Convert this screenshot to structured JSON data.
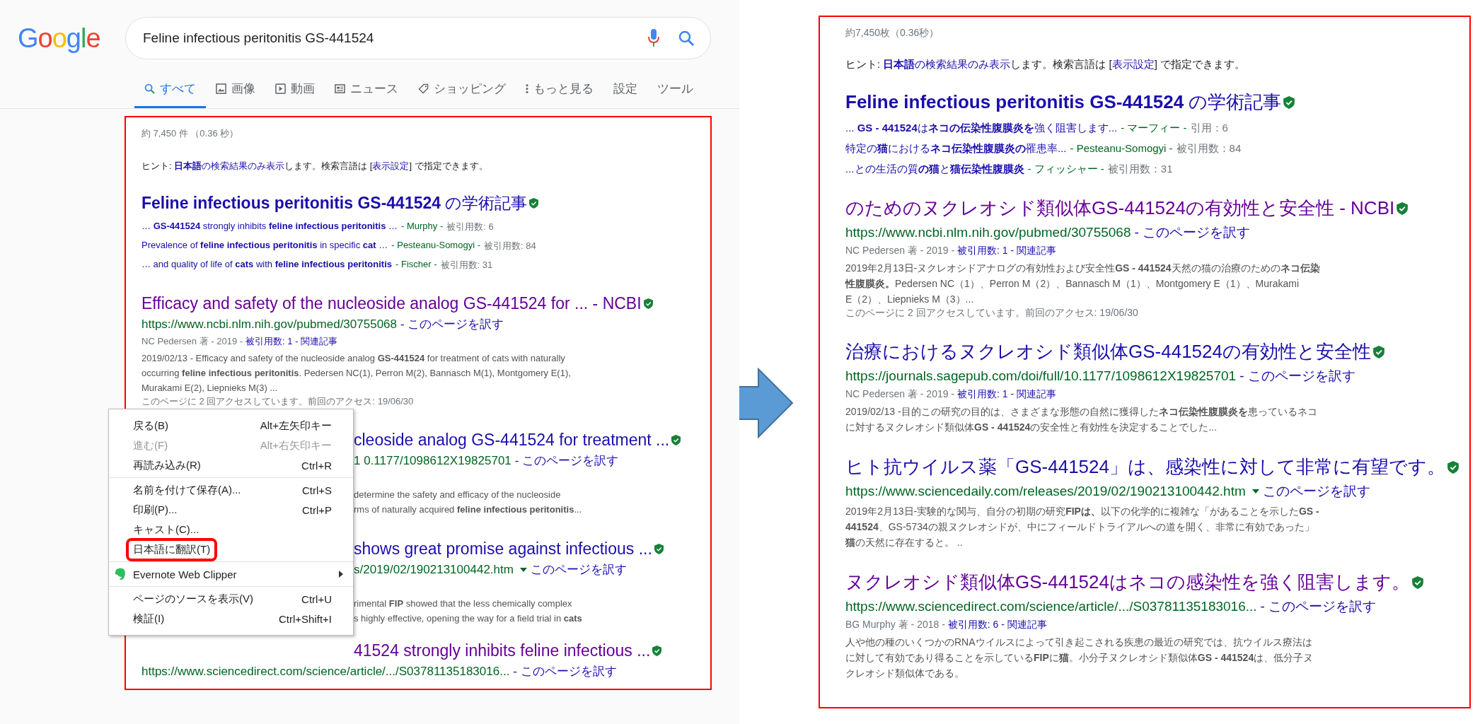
{
  "left": {
    "logo": [
      {
        "char": "G",
        "color": "#4285f4"
      },
      {
        "char": "o",
        "color": "#ea4335"
      },
      {
        "char": "o",
        "color": "#fbbc05"
      },
      {
        "char": "g",
        "color": "#4285f4"
      },
      {
        "char": "l",
        "color": "#34a853"
      },
      {
        "char": "e",
        "color": "#ea4335"
      }
    ],
    "search": {
      "value": "Feline infectious peritonitis GS-441524"
    },
    "tabs": [
      {
        "label": "すべて",
        "kind": "search",
        "selected": true
      },
      {
        "label": "画像",
        "kind": "image",
        "selected": false
      },
      {
        "label": "動画",
        "kind": "video",
        "selected": false
      },
      {
        "label": "ニュース",
        "kind": "news",
        "selected": false
      },
      {
        "label": "ショッピング",
        "kind": "tag",
        "selected": false
      },
      {
        "label": "もっと見る",
        "kind": "dots",
        "selected": false
      },
      {
        "label": "設定",
        "kind": "plain",
        "selected": false
      },
      {
        "label": "ツール",
        "kind": "plain",
        "selected": false
      }
    ],
    "stats": "約 7,450 件 （0.36 秒）",
    "hint": [
      {
        "kind": "text",
        "text": "ヒント: "
      },
      {
        "kind": "link",
        "text": "**日本語**の検索結果のみ表示"
      },
      {
        "kind": "text",
        "text": "します。検索言語は ["
      },
      {
        "kind": "link",
        "text": "表示設定"
      },
      {
        "kind": "text",
        "text": "] で指定できます。"
      }
    ],
    "scholar": {
      "title": "**Feline infectious peritonitis GS-441524** の学術記事",
      "verified": true,
      "lines": [
        {
          "text": "… **GS-441524** strongly inhibits **feline infectious peritonitis** …",
          "author": "- Murphy -",
          "cited": "被引用数: 6"
        },
        {
          "text": "Prevalence of **feline infectious peritonitis** in specific **cat** …",
          "author": "- Pesteanu-Somogyi -",
          "cited": "被引用数: 84"
        },
        {
          "text": "… and quality of life of **cats** with **feline infectious peritonitis**",
          "author": "- Fischer -",
          "cited": "被引用数: 31"
        }
      ]
    },
    "results": [
      {
        "kind": "web",
        "visited": true,
        "title": "Efficacy and safety of the nucleoside analog GS-441524 for ... - NCBI",
        "verified": true,
        "url": "https://www.ncbi.nlm.nih.gov/pubmed/30755068",
        "dropdown": false,
        "translate": "- このページを訳す",
        "meta": {
          "by": "NC Pedersen 著 - 2019 -",
          "cited": "被引用数: 1 -",
          "related": "関連記事"
        },
        "snippet": [
          "2019/02/13 - Efficacy and safety of the nucleoside analog **GS-441524** for treatment of cats with naturally",
          "occurring **feline infectious peritonitis**. Pedersen NC(1), Perron M(2), Bannasch M(1), Montgomery E(1),",
          "Murakami E(2), Liepnieks M(3) ..."
        ],
        "visit_note": "このページに 2 回アクセスしています。前回のアクセス: 19/06/30"
      },
      {
        "kind": "covered",
        "visited": false,
        "title": "cleoside analog GS-441524 for treatment ...",
        "verified": true,
        "url": "1 0.1177/1098612X19825701",
        "dropdown": false,
        "translate": "- このページを訳す",
        "snippet": [
          "determine the safety and efficacy of the nucleoside",
          "rms of naturally acquired **feline infectious peritonitis**..."
        ]
      },
      {
        "kind": "covered",
        "visited": false,
        "title": "shows great promise against infectious ...",
        "verified": true,
        "url": "s/2019/02/190213100442.htm",
        "dropdown": true,
        "translate": "このページを訳す",
        "snippet": [
          "rimental **FIP** showed that the less chemically complex",
          "s  highly effective, opening the way for a field trial in **cats**"
        ]
      },
      {
        "kind": "title-covered",
        "visited": true,
        "title": "41524 strongly inhibits feline infectious ...",
        "verified": true,
        "url": "https://www.sciencedirect.com/science/article/.../S03781135183016...",
        "dropdown": false,
        "translate": "- このページを訳す"
      }
    ],
    "context_menu": {
      "sections": [
        [
          {
            "label": "戻る(B)",
            "shortcut": "Alt+左矢印キー",
            "kind": "plain",
            "disabled": false,
            "highlighted": false
          },
          {
            "label": "進む(F)",
            "shortcut": "Alt+右矢印キー",
            "kind": "plain",
            "disabled": true,
            "highlighted": false
          },
          {
            "label": "再読み込み(R)",
            "shortcut": "Ctrl+R",
            "kind": "plain",
            "disabled": false,
            "highlighted": false
          }
        ],
        [
          {
            "label": "名前を付けて保存(A)...",
            "shortcut": "Ctrl+S",
            "kind": "plain",
            "disabled": false,
            "highlighted": false
          },
          {
            "label": "印刷(P)...",
            "shortcut": "Ctrl+P",
            "kind": "plain",
            "disabled": false,
            "highlighted": false
          },
          {
            "label": "キャスト(C)...",
            "kind": "plain",
            "disabled": false,
            "highlighted": false
          },
          {
            "label": "日本語に翻訳(T)",
            "kind": "plain",
            "disabled": false,
            "highlighted": true
          }
        ],
        [
          {
            "label": "Evernote Web Clipper",
            "kind": "submenu",
            "disabled": false,
            "highlighted": false
          }
        ],
        [
          {
            "label": "ページのソースを表示(V)",
            "shortcut": "Ctrl+U",
            "kind": "plain",
            "disabled": false,
            "highlighted": false
          },
          {
            "label": "検証(I)",
            "shortcut": "Ctrl+Shift+I",
            "kind": "plain",
            "disabled": false,
            "highlighted": false
          }
        ]
      ]
    }
  },
  "right": {
    "stats": "約7,450枚（0.36秒）",
    "hint": [
      {
        "kind": "text",
        "text": "ヒント: "
      },
      {
        "kind": "link",
        "text": "**日本語**の検索結果のみ表示"
      },
      {
        "kind": "text",
        "text": "します。検索言語は ["
      },
      {
        "kind": "link",
        "text": "表示設定"
      },
      {
        "kind": "text",
        "text": "] で指定できます。"
      }
    ],
    "scholar": {
      "title": "**Feline infectious peritonitis GS-441524** の学術記事",
      "verified": true,
      "lines": [
        {
          "text": "... **GS - 441524**は**ネコの伝染性腹膜炎を**強く阻害します...",
          "author": "- マーフィー -",
          "cited": "引用：6"
        },
        {
          "text": "特定の**猫**における**ネコ伝染性腹膜炎の**罹患率...",
          "author": "- Pesteanu-Somogyi -",
          "cited": "被引用数：84"
        },
        {
          "text": "...との生活の質**の猫**と**猫伝染性腹膜炎**",
          "author": "- フィッシャー -",
          "cited": "被引用数：31"
        }
      ]
    },
    "results": [
      {
        "kind": "web",
        "visited": true,
        "title": "のためのヌクレオシド類似体GS-441524の有効性と安全性 - NCBI",
        "verified": true,
        "url": "https://www.ncbi.nlm.nih.gov/pubmed/30755068",
        "dropdown": false,
        "translate": "- このページを訳す",
        "meta": {
          "by": "NC Pedersen 著 - 2019 -",
          "cited": "被引用数: 1 -",
          "related": "関連記事"
        },
        "snippet": [
          "2019年2月13日-ヌクレオシドアナログの有効性および安全性**GS - 441524**天然の猫の治療のための**ネコ伝染**",
          "**性腹膜炎。**Pedersen NC（1）、Perron M（2）、Bannasch M（1）、Montgomery E（1）、Murakami",
          "E（2）、Liepnieks M（3）..."
        ],
        "visit_note": "このページに 2 回アクセスしています。前回のアクセス: 19/06/30"
      },
      {
        "kind": "web",
        "visited": false,
        "title": "治療におけるヌクレオシド類似体GS-441524の有効性と安全性",
        "verified": true,
        "url": "https://journals.sagepub.com/doi/full/10.1177/1098612X19825701",
        "dropdown": false,
        "translate": "- このページを訳す",
        "meta": {
          "by": "NC Pedersen 著 - 2019 -",
          "cited": "被引用数: 1 -",
          "related": "関連記事"
        },
        "snippet": [
          "2019/02/13 -目的この研究の目的は、さまざまな形態の自然に獲得した**ネコ伝染性腹膜炎を**患っているネコ",
          "に対するヌクレオシド類似体**GS - 441524**の安全性と有効性を決定することでした..."
        ]
      },
      {
        "kind": "web",
        "visited": false,
        "title": "ヒト抗ウイルス薬「GS-441524」は、感染性に対して非常に有望です。",
        "verified": true,
        "url": "https://www.sciencedaily.com/releases/2019/02/190213100442.htm",
        "dropdown": true,
        "translate": "このページを訳す",
        "snippet": [
          "2019年2月13日-実験的な関与、自分の初期の研究**FIPは、**以下の化学的に複雑な「があることを示した**GS -**",
          "**441524**、GS-5734の親ヌクレオシドが、中にフィールドトライアルへの道を開く、非常に有効であった」",
          "**猫**の天然に存在すると。 .."
        ]
      },
      {
        "kind": "web",
        "visited": true,
        "title": "ヌクレオシド類似体GS-441524はネコの感染性を強く阻害します。",
        "verified": true,
        "url": "https://www.sciencedirect.com/science/article/.../S03781135183016...",
        "dropdown": false,
        "translate": "- このページを訳す",
        "meta": {
          "by": "BG Murphy 著 - 2018 -",
          "cited": "被引用数: 6 -",
          "related": "関連記事"
        },
        "snippet": [
          "人や他の種のいくつかのRNAウイルスによって引き起こされる疾患の最近の研究では、抗ウイルス療法は",
          "に対して有効であり得ることを示している**FIP**に**猫**。小分子ヌクレオシド類似体**GS - 441524**は、低分子ヌ",
          "クレオシド類似体である。"
        ]
      }
    ]
  }
}
